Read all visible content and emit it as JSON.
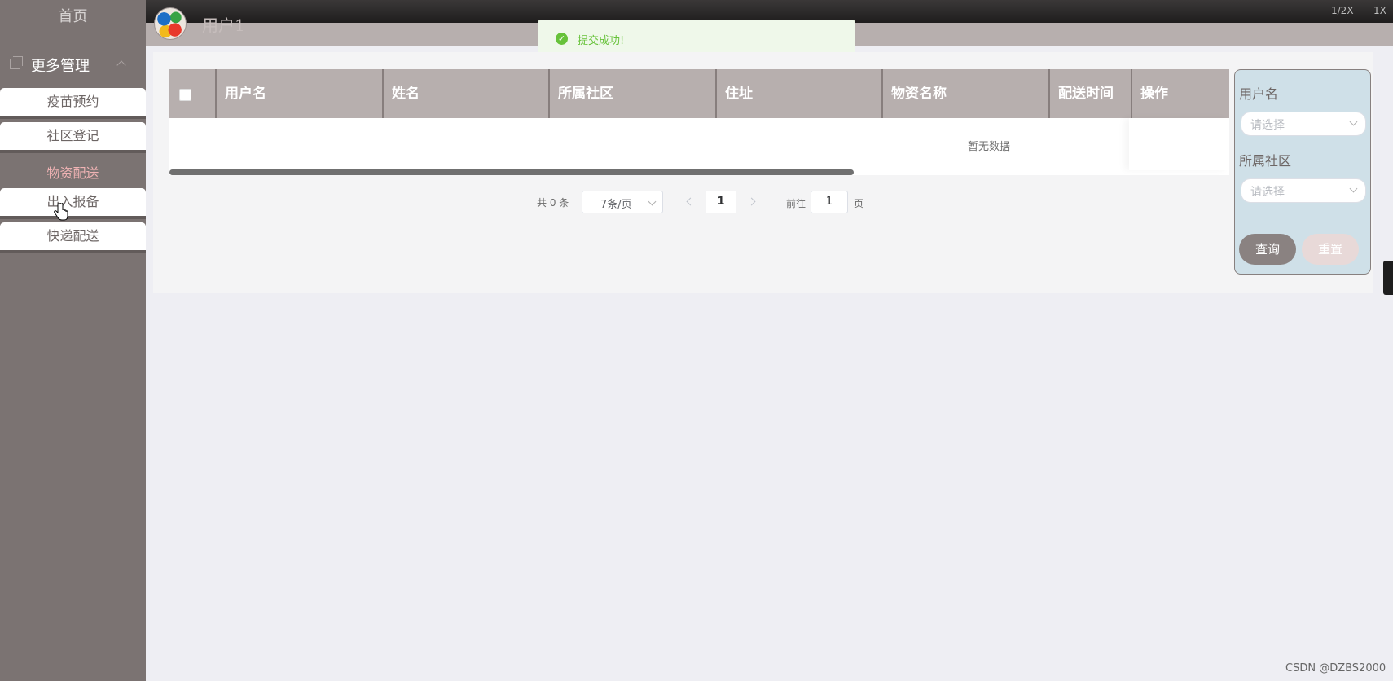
{
  "zoom": {
    "half": "1/2X",
    "one": "1X"
  },
  "sidebar": {
    "home": "首页",
    "group_label": "更多管理",
    "items": [
      {
        "label": "疫苗预约"
      },
      {
        "label": "社区登记"
      },
      {
        "label": "物资配送",
        "active": true
      },
      {
        "label": "出入报备"
      },
      {
        "label": "快递配送"
      }
    ]
  },
  "header": {
    "username": "用户1"
  },
  "toast": {
    "message": "提交成功!",
    "icon": "check-circle-icon",
    "color": "#67c23a"
  },
  "table": {
    "columns": [
      "用户名",
      "姓名",
      "所属社区",
      "住址",
      "物资名称",
      "配送时间",
      "操作"
    ],
    "empty_text": "暂无数据"
  },
  "pagination": {
    "total": "共 0 条",
    "page_size": "7条/页",
    "current": "1",
    "goto_prefix": "前往",
    "goto_value": "1",
    "goto_suffix": "页"
  },
  "filter": {
    "username_label": "用户名",
    "username_placeholder": "请选择",
    "community_label": "所属社区",
    "community_placeholder": "请选择",
    "query_button": "查询",
    "reset_button": "重置"
  },
  "watermark": "CSDN @DZBS2000",
  "colors": {
    "sidebar": "#7b7372",
    "header": "#b7afae",
    "active_menu": "#f0b3b4",
    "accent_button": "#8a8281"
  }
}
